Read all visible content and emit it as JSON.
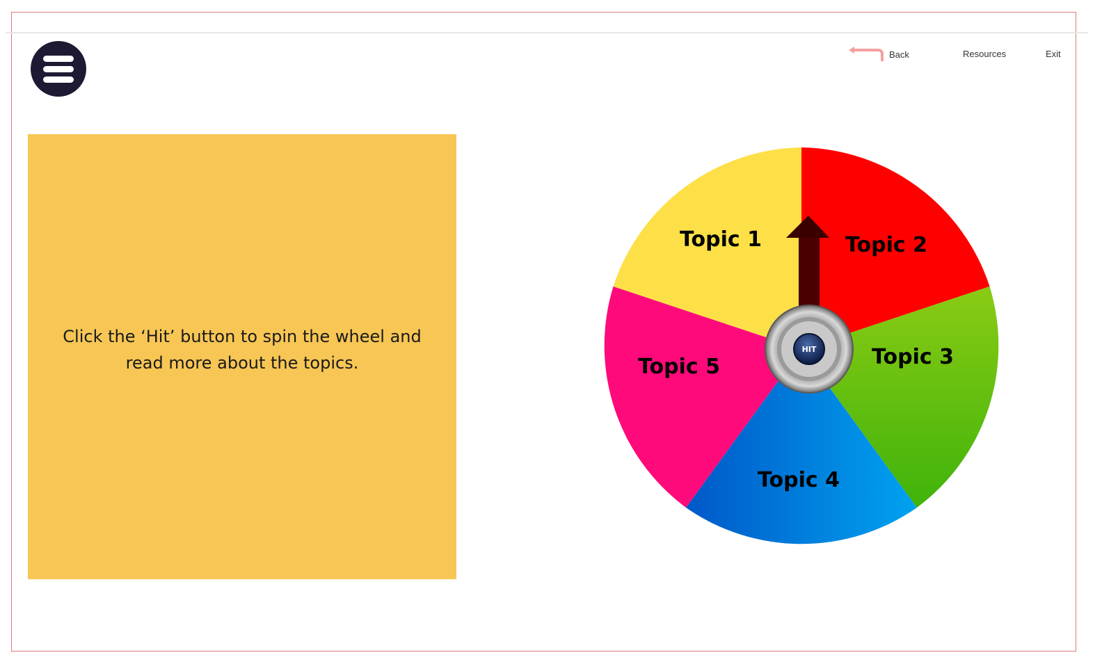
{
  "header": {
    "menu_icon": "hamburger-menu-icon",
    "back_icon": "back-arrow-icon",
    "back_label": "Back",
    "resources_label": "Resources",
    "exit_label": "Exit"
  },
  "info_panel": {
    "text": "Click the ‘Hit’ button to spin the wheel and read more about the topics.",
    "background": "#f7c654"
  },
  "wheel": {
    "hit_label": "HIT",
    "pointer_icon": "arrow-up-icon",
    "segments": [
      {
        "label": "Topic 1",
        "color": "#fde047"
      },
      {
        "label": "Topic 2",
        "color": "#ff0000"
      },
      {
        "label": "Topic 3",
        "color": "#66bb10"
      },
      {
        "label": "Topic 4",
        "color": "#0077dd"
      },
      {
        "label": "Topic 5",
        "color": "#ff0a7a"
      }
    ]
  }
}
